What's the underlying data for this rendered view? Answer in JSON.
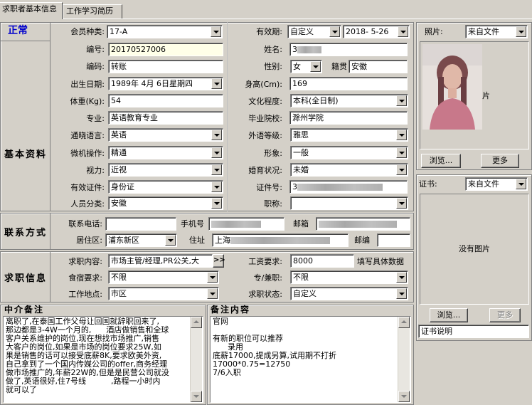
{
  "tabs": [
    {
      "label": "求职者基本信息",
      "active": true
    },
    {
      "label": "工作学习简历",
      "active": false
    }
  ],
  "status": {
    "text": "正常",
    "color": "#0000cc"
  },
  "sections": {
    "basic": "基本资料",
    "contact": "联系方式",
    "job": "求职信息"
  },
  "basic": {
    "member_type": {
      "label": "会员种类:",
      "value": "17-A"
    },
    "validity": {
      "label": "有效期:",
      "mode": "自定义",
      "date": "2018- 5-26"
    },
    "number": {
      "label": "编号:",
      "value": "20170527006"
    },
    "name": {
      "label": "姓名:",
      "value": "3"
    },
    "code": {
      "label": "编码:",
      "value": "转账"
    },
    "gender": {
      "label": "性别:",
      "value": "女"
    },
    "hometown": {
      "label": "籍贯",
      "value": "安徽"
    },
    "birth": {
      "label": "出生日期:",
      "value": "1989年 4月 6日星期四"
    },
    "height": {
      "label": "身高(Cm):",
      "value": "169"
    },
    "weight": {
      "label": "体重(Kg):",
      "value": "54"
    },
    "education": {
      "label": "文化程度:",
      "value": "本科(全日制)"
    },
    "major": {
      "label": "专业:",
      "value": "英语教育专业"
    },
    "school": {
      "label": "毕业院校:",
      "value": "滁州学院"
    },
    "language": {
      "label": "通晓语言:",
      "value": "英语"
    },
    "foreign_level": {
      "label": "外语等级:",
      "value": "雅思"
    },
    "computer": {
      "label": "微机操作:",
      "value": "精通"
    },
    "appearance": {
      "label": "形象:",
      "value": "一般"
    },
    "eyesight": {
      "label": "视力:",
      "value": "近视"
    },
    "marital": {
      "label": "婚育状况:",
      "value": "未婚"
    },
    "id_type": {
      "label": "有效证件:",
      "value": "身份证"
    },
    "id_no": {
      "label": "证件号:",
      "value": "3"
    },
    "category": {
      "label": "人员分类:",
      "value": "安徽"
    },
    "title": {
      "label": "职称:",
      "value": ""
    }
  },
  "contact": {
    "phone": {
      "label": "联系电话:",
      "value": ""
    },
    "mobile": {
      "label": "手机号",
      "value": ""
    },
    "email": {
      "label": "邮箱",
      "value": ""
    },
    "district": {
      "label": "居住区:",
      "value": "浦东新区"
    },
    "address": {
      "label": "住址",
      "value": "上海"
    },
    "postcode": {
      "label": "邮编",
      "value": ""
    }
  },
  "job": {
    "content": {
      "label": "求职内容:",
      "value": "市场主管/经理,PR公关,大",
      "more": ">>"
    },
    "salary": {
      "label": "工资要求:",
      "value": "8000",
      "hint": "填写具体数据"
    },
    "board": {
      "label": "食宿要求:",
      "value": "不限"
    },
    "fulltime": {
      "label": "专/兼职:",
      "value": "不限"
    },
    "location": {
      "label": "工作地点:",
      "value": "市区"
    },
    "status": {
      "label": "求职状态:",
      "value": "自定义"
    }
  },
  "agent_note": {
    "title": "中介备注",
    "lines": [
      "离职了,在泰国工作父母让回国就辞职回来了,",
      "那边都是3-4W一个月的,      酒店做销售和全球",
      "客户关系维护的岗位,现在想找市场推广,销售",
      "大客户的岗位,如果是市场的岗位要求25W,如",
      "果是销售的话可以接受底薪8K,要求欧美外资,",
      "自己拿到了一个国内传媒公司的offer,商务经理",
      "做市场推广的,年薪22W的,但是是民营公司就没",
      "做了,英语很好,住7号线          ,路程一小时内",
      "就可以了"
    ]
  },
  "remark": {
    "title": "备注内容",
    "lines": [
      "官网",
      "",
      "有新的职位可以推荐",
      "      录用",
      "底薪17000,提成另算,试用期不打折",
      "17000*0.75=12750",
      "7/6入职"
    ]
  },
  "photo": {
    "label": "照片:",
    "source": "来自文件",
    "side_text": "片",
    "browse": "浏览...",
    "more": "更多"
  },
  "certificate": {
    "label": "证书:",
    "source": "来自文件",
    "empty": "没有图片",
    "browse": "浏览...",
    "more": "更多",
    "desc": "证书说明"
  }
}
